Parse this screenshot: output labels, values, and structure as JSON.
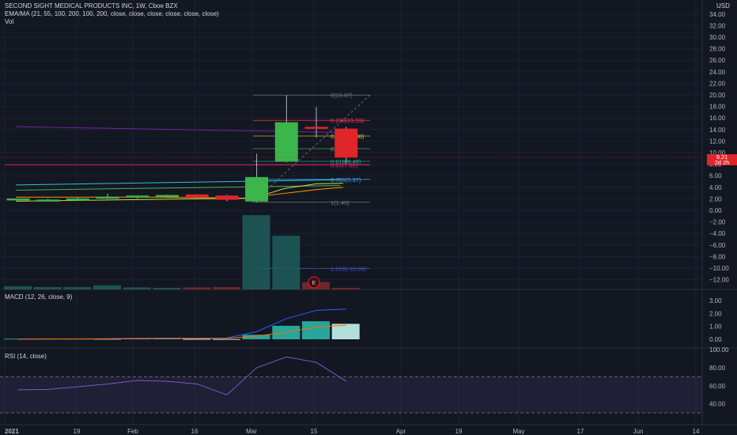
{
  "header": {
    "title": "SECOND SIGHT MEDICAL PRODUCTS INC, 1W, Cboe BZX",
    "ema_legend": "EMA/MA (21, 55, 100, 200, 100, 200, close, close, close, close, close, close)",
    "vol_legend": "Vol",
    "currency": "USD"
  },
  "last_price": {
    "value": "9.21",
    "countdown": "2d 2h",
    "color": "#e0252b"
  },
  "colors": {
    "up": "#3cb54a",
    "down": "#e0252b",
    "background": "#131722"
  },
  "chart_data": [
    {
      "type": "candlestick",
      "title": "SECOND SIGHT MEDICAL PRODUCTS INC, 1W, Cboe BZX",
      "y_ticks": [
        34,
        32,
        30,
        28,
        26,
        24,
        22,
        20,
        18,
        16,
        14,
        12,
        10,
        8,
        6,
        4,
        2,
        0,
        -2,
        -4,
        -6,
        -8,
        -10,
        -12
      ],
      "x_ticks": [
        "2021",
        "19",
        "Feb",
        "16",
        "Mar",
        "15",
        "Apr",
        "19",
        "May",
        "17",
        "Jun",
        "14"
      ],
      "candles": [
        {
          "o": 1.8,
          "h": 2.1,
          "l": 1.6,
          "c": 2.0
        },
        {
          "o": 1.7,
          "h": 2.0,
          "l": 1.5,
          "c": 1.8
        },
        {
          "o": 1.8,
          "h": 2.2,
          "l": 1.7,
          "c": 2.0
        },
        {
          "o": 2.1,
          "h": 2.9,
          "l": 2.0,
          "c": 2.3
        },
        {
          "o": 2.3,
          "h": 2.6,
          "l": 2.0,
          "c": 2.5
        },
        {
          "o": 2.4,
          "h": 2.7,
          "l": 2.2,
          "c": 2.6
        },
        {
          "o": 2.7,
          "h": 2.8,
          "l": 2.1,
          "c": 2.3
        },
        {
          "o": 2.5,
          "h": 2.7,
          "l": 1.6,
          "c": 1.9
        },
        {
          "o": 1.6,
          "h": 9.8,
          "l": 1.4,
          "c": 5.7
        },
        {
          "o": 8.5,
          "h": 19.97,
          "l": 8.3,
          "c": 15.2
        },
        {
          "o": 14.4,
          "h": 17.9,
          "l": 12.6,
          "c": 14.3
        },
        {
          "o": 14.1,
          "h": 14.5,
          "l": 8.2,
          "c": 9.21
        }
      ],
      "fibonacci": [
        {
          "label": "0(19.97)",
          "value": 19.97,
          "color": "#787b86"
        },
        {
          "label": "0.236(15.59)",
          "value": 15.59,
          "color": "#f23645"
        },
        {
          "label": "0.382(12.88)",
          "value": 12.88,
          "color": "#c0ca33"
        },
        {
          "label": "0.5(10.69)",
          "value": 10.69,
          "color": "#4caf50"
        },
        {
          "label": "0.618(8.49)",
          "value": 8.49,
          "color": "#26a69a"
        },
        {
          "label": "0.65(7.90)",
          "value": 7.9,
          "color": "#e91e63"
        },
        {
          "label": "0.786(5.37)",
          "value": 5.37,
          "color": "#42a5f5"
        },
        {
          "label": "1(1.40)",
          "value": 1.4,
          "color": "#787b86"
        },
        {
          "label": "1.618(-10.08)",
          "value": -10.08,
          "color": "#3f51b5"
        }
      ],
      "volume": [
        0.4,
        0.3,
        0.3,
        0.5,
        0.25,
        0.2,
        0.25,
        0.3,
        9.0,
        6.5,
        0.9,
        0.2
      ],
      "event_marker": "E"
    },
    {
      "type": "line",
      "title": "MACD (12, 26, close, 9)",
      "y_ticks": [
        3.0,
        2.0,
        1.0,
        0.0
      ],
      "histogram": [
        0.05,
        0.05,
        0.05,
        0.04,
        0.08,
        0.08,
        0.03,
        0.02,
        0.35,
        1.05,
        1.4,
        1.2
      ],
      "macd": [
        0.02,
        0.03,
        0.03,
        0.05,
        0.08,
        0.09,
        0.08,
        0.1,
        0.6,
        1.6,
        2.25,
        2.35
      ],
      "signal": [
        0.01,
        0.02,
        0.02,
        0.03,
        0.05,
        0.06,
        0.07,
        0.08,
        0.25,
        0.55,
        0.95,
        1.1
      ]
    },
    {
      "type": "line",
      "title": "RSI (14, close)",
      "y_ticks": [
        100.0,
        80.0,
        60.0,
        40.0
      ],
      "values": [
        55.5,
        56,
        59,
        62,
        66,
        65,
        62,
        50,
        80,
        92,
        86,
        65
      ]
    }
  ]
}
